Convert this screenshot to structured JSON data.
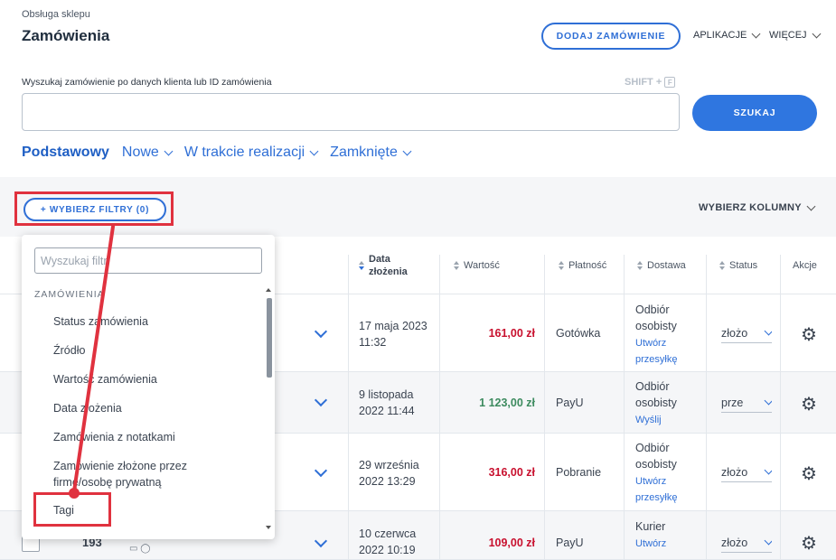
{
  "header": {
    "breadcrumb": "Obsługa sklepu",
    "title": "Zamówienia",
    "add_order_label": "DODAJ ZAMÓWIENIE",
    "apps_label": "APLIKACJE",
    "more_label": "WIĘCEJ"
  },
  "search": {
    "label": "Wyszukaj zamówienie po danych klienta lub ID zamówienia",
    "shortcut_prefix": "SHIFT +",
    "shortcut_key": "F",
    "value": "",
    "button_label": "SZUKAJ"
  },
  "tabs": [
    {
      "label": "Podstawowy",
      "active": true
    },
    {
      "label": "Nowe",
      "active": false
    },
    {
      "label": "W trakcie realizacji",
      "active": false
    },
    {
      "label": "Zamknięte",
      "active": false
    }
  ],
  "toolbar": {
    "filters_label": "+ WYBIERZ FILTRY (0)",
    "columns_label": "WYBIERZ KOLUMNY"
  },
  "table": {
    "headers": {
      "date": "Data złożenia",
      "value": "Wartość",
      "payment": "Płatność",
      "delivery": "Dostawa",
      "status": "Status",
      "actions": "Akcje"
    },
    "rows": [
      {
        "date": "17 maja 2023 11:32",
        "value": "161,00 zł",
        "payment": "Gotówka",
        "delivery": "Odbiór osobisty",
        "delivery_link": "Utwórz przesyłkę",
        "status": "złożo"
      },
      {
        "date": "9 listopada 2022 11:44",
        "value": "1 123,00 zł",
        "payment": "PayU",
        "delivery": "Odbiór osobisty",
        "delivery_link": "Wyślij",
        "status": "prze"
      },
      {
        "date": "29 września 2022 13:29",
        "value": "316,00 zł",
        "payment": "Pobranie",
        "delivery": "Odbiór osobisty",
        "delivery_link": "Utwórz przesyłkę",
        "status": "złożo"
      },
      {
        "id": "193",
        "date": "10 czerwca 2022 10:19",
        "value": "109,00 zł",
        "payment": "PayU",
        "delivery": "Kurier",
        "delivery_link": "Utwórz",
        "status": "złożo"
      }
    ]
  },
  "filter_dropdown": {
    "search_placeholder": "Wyszukaj filtr",
    "section": "ZAMÓWIENIA",
    "items": [
      "Status zamówienia",
      "Źródło",
      "Wartość zamówienia",
      "Data złożenia",
      "Zamówienia z notatkami",
      "Zamówienie złożone przez firmę/osobę prywatną",
      "Tagi"
    ]
  },
  "colors": {
    "accent": "#2f6fd6",
    "highlight": "#e0323f",
    "price_red": "#c8102e",
    "price_green": "#3d8b5f"
  },
  "icons": [
    "chevron-down-icon",
    "sort-icon",
    "gear-icon",
    "expand-icon",
    "checkbox-icon",
    "user-icon"
  ]
}
